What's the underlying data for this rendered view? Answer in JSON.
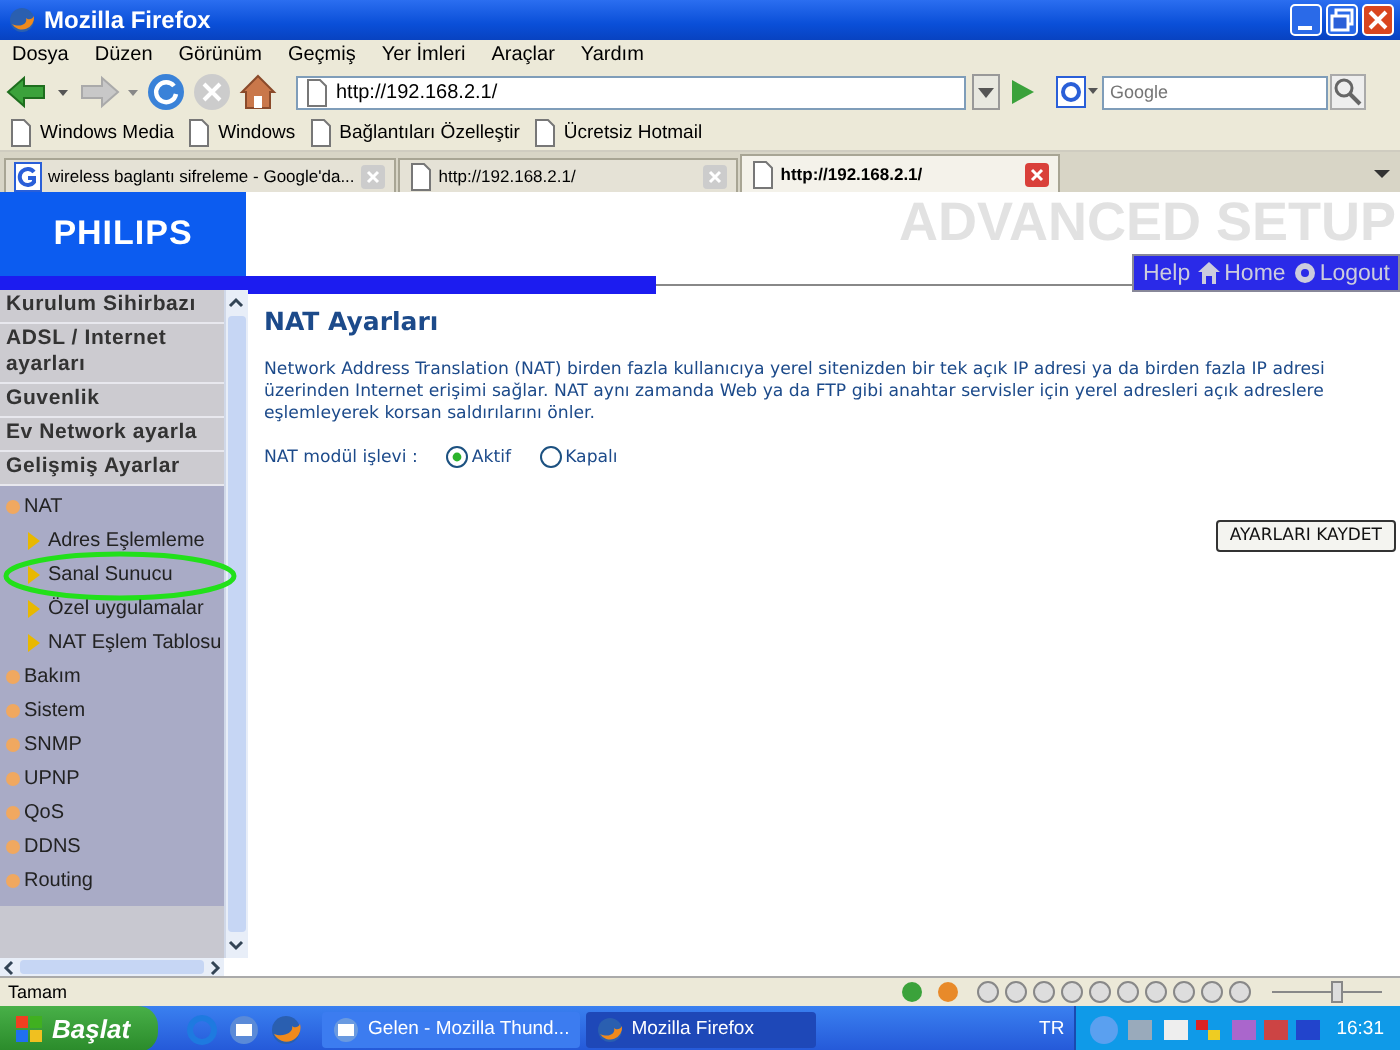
{
  "window": {
    "title": "Mozilla Firefox"
  },
  "menu_bar": [
    "Dosya",
    "Düzen",
    "Görünüm",
    "Geçmiş",
    "Yer İmleri",
    "Araçlar",
    "Yardım"
  ],
  "nav_toolbar": {
    "address": "http://192.168.2.1/",
    "search_placeholder": "Google"
  },
  "bookmarks": [
    "Windows Media",
    "Windows",
    "Bağlantıları Özelleştir",
    "Ücretsiz Hotmail"
  ],
  "tabs": [
    {
      "label": "wireless baglantı sifreleme - Google'da...",
      "kind": "google",
      "selected": false
    },
    {
      "label": "http://192.168.2.1/",
      "kind": "page",
      "selected": false
    },
    {
      "label": "http://192.168.2.1/",
      "kind": "page",
      "selected": true
    }
  ],
  "page": {
    "logo": "PHILIPS",
    "banner": "ADVANCED SETUP",
    "top_links": [
      {
        "label": "Help",
        "kind": "text"
      },
      {
        "label": "Home",
        "kind": "home"
      },
      {
        "label": "Logout",
        "kind": "logout"
      }
    ],
    "sidebar": [
      {
        "label": "Kurulum Sihirbazı",
        "kind": "section"
      },
      {
        "label": "ADSL / Internet ayarları",
        "kind": "section"
      },
      {
        "label": "Guvenlik",
        "kind": "section"
      },
      {
        "label": "Ev Network ayarla",
        "kind": "section"
      },
      {
        "label": "Gelişmiş Ayarlar",
        "kind": "section"
      },
      {
        "label": "NAT",
        "kind": "bullet",
        "children": [
          {
            "label": "Adres Eşlemleme",
            "circled": false
          },
          {
            "label": "Sanal Sunucu",
            "circled": true
          },
          {
            "label": "Özel uygulamalar",
            "circled": false
          },
          {
            "label": "NAT Eşlem Tablosu",
            "circled": false
          }
        ]
      },
      {
        "label": "Bakım",
        "kind": "bullet"
      },
      {
        "label": "Sistem",
        "kind": "bullet"
      },
      {
        "label": "SNMP",
        "kind": "bullet"
      },
      {
        "label": "UPNP",
        "kind": "bullet"
      },
      {
        "label": "QoS",
        "kind": "bullet"
      },
      {
        "label": "DDNS",
        "kind": "bullet"
      },
      {
        "label": "Routing",
        "kind": "bullet"
      }
    ],
    "content": {
      "title": "NAT Ayarları",
      "description": "Network Address Translation (NAT) birden fazla kullanıcıya yerel sitenizden bir tek açık IP adresi ya da birden fazla IP adresi üzerinden Internet erişimi sağlar. NAT aynı zamanda Web ya da FTP gibi anahtar servisler için yerel adresleri açık adreslere eşlemleyerek korsan saldırılarını önler.",
      "field_label": "NAT modül işlevi :",
      "options": [
        {
          "label": "Aktif",
          "selected": true
        },
        {
          "label": "Kapalı",
          "selected": false
        }
      ],
      "save_button": "AYARLARI KAYDET"
    }
  },
  "status_bar": {
    "text": "Tamam"
  },
  "taskbar": {
    "start": "Başlat",
    "tasks": [
      {
        "label": "Gelen - Mozilla Thund...",
        "kind": "mail",
        "selected": false
      },
      {
        "label": "Mozilla Firefox",
        "kind": "browser",
        "selected": true
      }
    ],
    "language": "TR",
    "clock": "16:31"
  }
}
